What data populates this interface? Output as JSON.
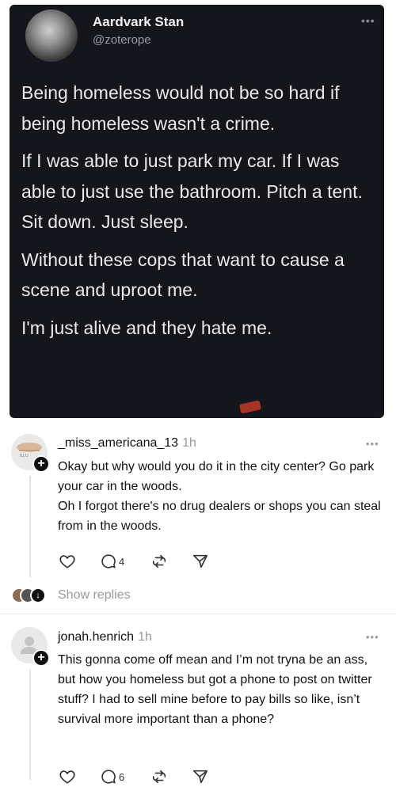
{
  "tweet": {
    "author_name": "Aardvark Stan",
    "author_handle": "@zoterope",
    "more_label": "•••",
    "paragraphs": [
      "Being homeless would not be so hard if being homeless wasn't a crime.",
      "If I was able to just park my car. If I was able to just use the bathroom. Pitch a tent. Sit down. Just sleep.",
      "Without these cops that want to cause a scene and uproot me.",
      "I'm just alive and they hate me."
    ]
  },
  "comments": [
    {
      "username": "_miss_americana_13",
      "time": "1h",
      "more_label": "•••",
      "text": "Okay but why would you do it in the city center? Go park your car in the woods.\nOh I forgot there's no drug dealers or shops you can steal from in the woods.",
      "reply_count": "4",
      "show_replies_label": "Show replies"
    },
    {
      "username": "jonah.henrich",
      "time": "1h",
      "more_label": "•••",
      "text": "This gonna come off mean and I’m not tryna be an ass, but how you homeless but got a phone to post on twitter stuff? I had to sell mine before to pay bills so like, isn’t survival more important than a phone?",
      "reply_count": "6"
    }
  ],
  "icons": {
    "like": "heart-icon",
    "reply": "comment-bubble-icon",
    "repost": "repost-icon",
    "share": "send-icon",
    "follow": "plus-icon",
    "expand": "arrow-down-icon"
  },
  "colors": {
    "tweet_bg": "#15161c",
    "tweet_text": "#eaeaea",
    "secondary_text": "#999999"
  }
}
